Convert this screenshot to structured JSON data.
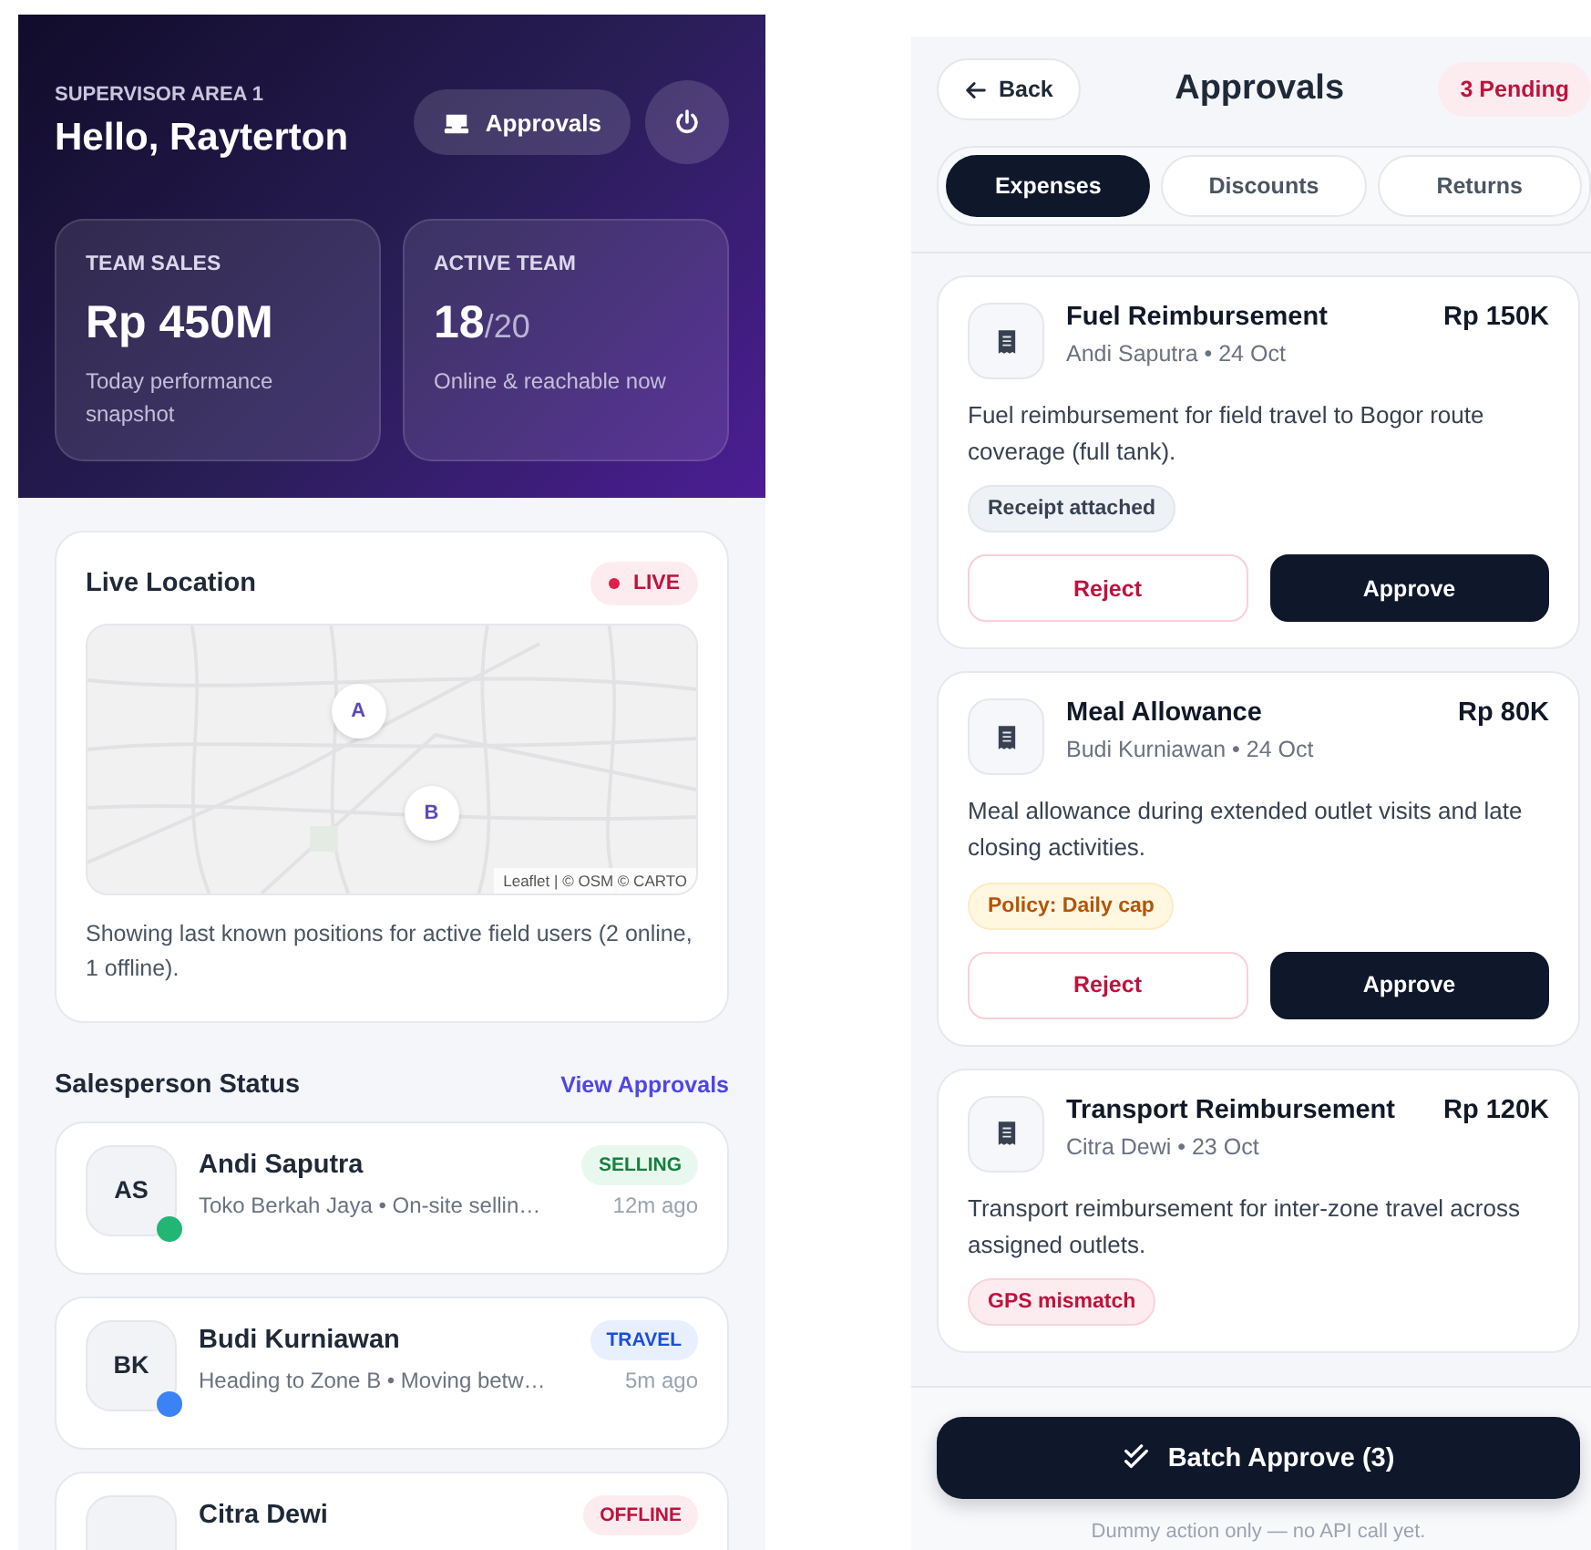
{
  "dashboard": {
    "eyebrow": "SUPERVISOR AREA 1",
    "greeting": "Hello, Rayterton",
    "approvals_button": "Approvals",
    "stats": [
      {
        "label": "TEAM SALES",
        "value": "Rp 450M",
        "caption": "Today performance snapshot"
      },
      {
        "label": "ACTIVE TEAM",
        "value": "18",
        "suffix": "/20",
        "caption": "Online & reachable now"
      }
    ],
    "live_location": {
      "title": "Live Location",
      "badge": "LIVE",
      "markers": [
        "A",
        "B"
      ],
      "attribution": "Leaflet | © OSM © CARTO",
      "caption": "Showing last known positions for active field users (2 online, 1 offline)."
    },
    "salesperson_section": {
      "title": "Salesperson Status",
      "link": "View Approvals"
    },
    "salespeople": [
      {
        "initials": "AS",
        "name": "Andi Saputra",
        "status": "SELLING",
        "kind": "selling",
        "detail": "Toko Berkah Jaya • On-site sellin…",
        "time": "12m ago",
        "color": "#22b573"
      },
      {
        "initials": "BK",
        "name": "Budi Kurniawan",
        "status": "TRAVEL",
        "kind": "travel",
        "detail": "Heading to Zone B • Moving betw…",
        "time": "5m ago",
        "color": "#3b82f6"
      },
      {
        "name": "Citra Dewi",
        "status": "OFFLINE",
        "kind": "offline"
      }
    ]
  },
  "approvals": {
    "back": "Back",
    "title": "Approvals",
    "pending": "3 Pending",
    "tabs": [
      {
        "label": "Expenses",
        "selected": true
      },
      {
        "label": "Discounts",
        "selected": false
      },
      {
        "label": "Returns",
        "selected": false
      }
    ],
    "items": [
      {
        "title": "Fuel Reimbursement",
        "amount": "Rp 150K",
        "meta": "Andi Saputra • 24 Oct",
        "description": "Fuel reimbursement for field travel to Bogor route coverage (full tank).",
        "tag": "Receipt attached",
        "kind": "neutral",
        "reject": "Reject",
        "approve": "Approve"
      },
      {
        "title": "Meal Allowance",
        "amount": "Rp 80K",
        "meta": "Budi Kurniawan • 24 Oct",
        "description": "Meal allowance during extended outlet visits and late closing activities.",
        "tag": "Policy: Daily cap",
        "kind": "warning",
        "reject": "Reject",
        "approve": "Approve"
      },
      {
        "title": "Transport Reimbursement",
        "amount": "Rp 120K",
        "meta": "Citra Dewi • 23 Oct",
        "description": "Transport reimbursement for inter-zone travel across assigned outlets.",
        "tag": "GPS mismatch",
        "kind": "danger"
      }
    ],
    "batch_button": "Batch Approve (3)",
    "note": "Dummy action only — no API call yet."
  }
}
